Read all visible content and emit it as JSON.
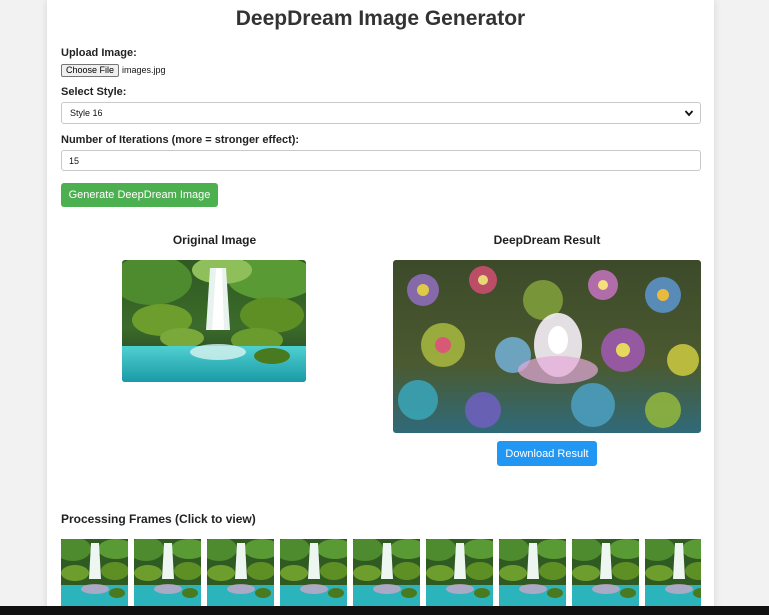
{
  "page": {
    "title": "DeepDream Image Generator"
  },
  "upload": {
    "label": "Upload Image:",
    "button_label": "Choose File",
    "file_name": "images.jpg"
  },
  "style_select": {
    "label": "Select Style:",
    "selected": "Style 16"
  },
  "iterations": {
    "label": "Number of Iterations (more = stronger effect):",
    "value": "15"
  },
  "generate_button": "Generate DeepDream Image",
  "original": {
    "title": "Original Image"
  },
  "result": {
    "title": "DeepDream Result",
    "download_label": "Download Result"
  },
  "frames": {
    "title": "Processing Frames (Click to view)",
    "count_visible": 9
  },
  "colors": {
    "generate_button": "#4caf50",
    "download_button": "#2196f3"
  }
}
